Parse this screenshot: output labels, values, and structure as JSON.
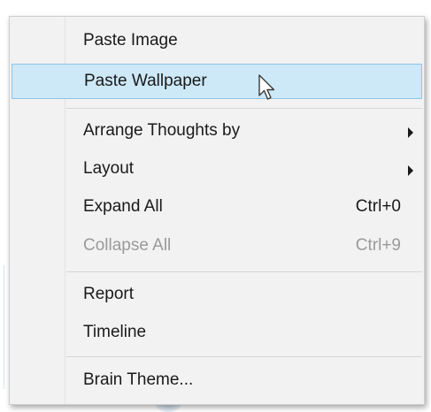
{
  "context_menu": {
    "items": [
      {
        "label": "Paste Image",
        "shortcut": "",
        "submenu": false,
        "disabled": false,
        "highlighted": false
      },
      {
        "label": "Paste Wallpaper",
        "shortcut": "",
        "submenu": false,
        "disabled": false,
        "highlighted": true
      },
      {
        "label": "Arrange Thoughts by",
        "shortcut": "",
        "submenu": true,
        "disabled": false,
        "highlighted": false
      },
      {
        "label": "Layout",
        "shortcut": "",
        "submenu": true,
        "disabled": false,
        "highlighted": false
      },
      {
        "label": "Expand All",
        "shortcut": "Ctrl+0",
        "submenu": false,
        "disabled": false,
        "highlighted": false
      },
      {
        "label": "Collapse All",
        "shortcut": "Ctrl+9",
        "submenu": false,
        "disabled": true,
        "highlighted": false
      },
      {
        "label": "Report",
        "shortcut": "",
        "submenu": false,
        "disabled": false,
        "highlighted": false
      },
      {
        "label": "Timeline",
        "shortcut": "",
        "submenu": false,
        "disabled": false,
        "highlighted": false
      },
      {
        "label": "Brain Theme...",
        "shortcut": "",
        "submenu": false,
        "disabled": false,
        "highlighted": false
      }
    ]
  },
  "colors": {
    "highlight_fill": "#cde8f7",
    "highlight_border": "#8ec5e6",
    "menu_background": "#f2f2f2",
    "disabled_text": "#9a9a9a"
  },
  "icons": {
    "submenu": "chevron-right-icon",
    "cursor": "mouse-pointer-icon"
  }
}
